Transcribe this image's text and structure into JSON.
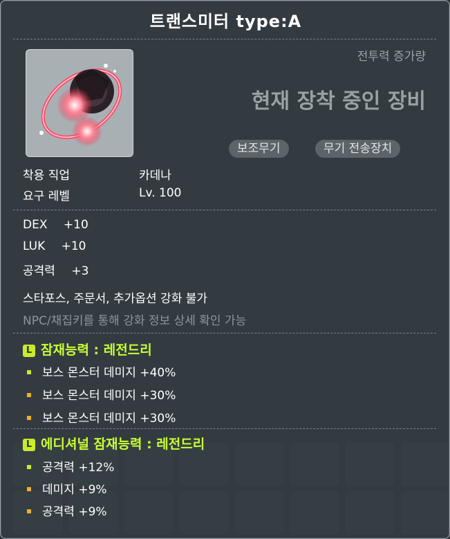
{
  "item": {
    "name": "트랜스미터 type:A",
    "cp_label": "전투력 증가량",
    "equipped_label": "현재 장착 중인 장비",
    "tags": [
      "보조무기",
      "무기 전송장치"
    ],
    "req_job_label": "착용 직업",
    "req_job_value": "카데나",
    "req_level_label": "요구 레벨",
    "req_level_value": "Lv. 100"
  },
  "stats": [
    {
      "name": "DEX",
      "value": "+10"
    },
    {
      "name": "LUK",
      "value": "+10"
    },
    {
      "name": "공격력",
      "value": "+3"
    }
  ],
  "notes": {
    "no_enhance": "스타포스, 주문서, 추가옵션 강화 불가",
    "npc_hint": "NPC/채집키를 통해 강화 정보 상세 확인 가능"
  },
  "potential": {
    "badge": "L",
    "title": "잠재능력 : 레전드리",
    "lines": [
      "보스 몬스터 데미지 +40%",
      "보스 몬스터 데미지 +30%",
      "보스 몬스터 데미지 +30%"
    ]
  },
  "additional": {
    "badge": "L",
    "title": "에디셔널 잠재능력 : 레전드리",
    "lines": [
      "공격력 +12%",
      "데미지 +9%",
      "공격력 +9%"
    ]
  },
  "colors": {
    "legendary": "#c8ff33",
    "bullet_first": "#c9ea2d",
    "bullet_other": "#f0b020"
  }
}
